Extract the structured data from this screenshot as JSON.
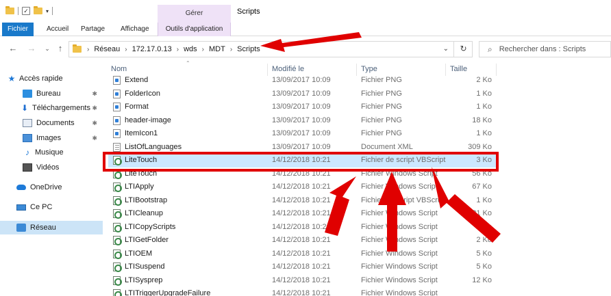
{
  "window": {
    "title": "Scripts",
    "context_group": "Gérer"
  },
  "ribbon": {
    "tabs": [
      {
        "label": "Fichier"
      },
      {
        "label": "Accueil"
      },
      {
        "label": "Partage"
      },
      {
        "label": "Affichage"
      },
      {
        "label": "Outils d'application"
      }
    ]
  },
  "address": {
    "crumbs": [
      "Réseau",
      "172.17.0.13",
      "wds",
      "MDT",
      "Scripts"
    ]
  },
  "search": {
    "placeholder": "Rechercher dans : Scripts"
  },
  "sidebar": {
    "items": [
      {
        "label": "Accès rapide",
        "icon": "star-icon"
      },
      {
        "label": "Bureau",
        "icon": "desktop-icon",
        "pinned": true
      },
      {
        "label": "Téléchargements",
        "icon": "download-icon",
        "pinned": true
      },
      {
        "label": "Documents",
        "icon": "documents-icon",
        "pinned": true
      },
      {
        "label": "Images",
        "icon": "images-icon",
        "pinned": true
      },
      {
        "label": "Musique",
        "icon": "music-icon"
      },
      {
        "label": "Vidéos",
        "icon": "videos-icon"
      },
      {
        "label": "OneDrive",
        "icon": "onedrive-icon"
      },
      {
        "label": "Ce PC",
        "icon": "computer-icon"
      },
      {
        "label": "Réseau",
        "icon": "network-icon",
        "selected": true
      }
    ]
  },
  "columns": {
    "name": "Nom",
    "date": "Modifié le",
    "type": "Type",
    "size": "Taille"
  },
  "files": [
    {
      "name": "Extend",
      "date": "13/09/2017 10:09",
      "type": "Fichier PNG",
      "size": "2 Ko",
      "kind": "png"
    },
    {
      "name": "FolderIcon",
      "date": "13/09/2017 10:09",
      "type": "Fichier PNG",
      "size": "1 Ko",
      "kind": "png"
    },
    {
      "name": "Format",
      "date": "13/09/2017 10:09",
      "type": "Fichier PNG",
      "size": "1 Ko",
      "kind": "png"
    },
    {
      "name": "header-image",
      "date": "13/09/2017 10:09",
      "type": "Fichier PNG",
      "size": "18 Ko",
      "kind": "png"
    },
    {
      "name": "ItemIcon1",
      "date": "13/09/2017 10:09",
      "type": "Fichier PNG",
      "size": "1 Ko",
      "kind": "png"
    },
    {
      "name": "ListOfLanguages",
      "date": "13/09/2017 10:09",
      "type": "Document XML",
      "size": "309 Ko",
      "kind": "xml"
    },
    {
      "name": "LiteTouch",
      "date": "14/12/2018 10:21",
      "type": "Fichier de script VBScript",
      "size": "3 Ko",
      "kind": "script",
      "highlighted": true
    },
    {
      "name": "LiteTouch",
      "date": "14/12/2018 10:21",
      "type": "Fichier Windows Script",
      "size": "56 Ko",
      "kind": "script"
    },
    {
      "name": "LTIApply",
      "date": "14/12/2018 10:21",
      "type": "Fichier Windows Script",
      "size": "67 Ko",
      "kind": "script"
    },
    {
      "name": "LTIBootstrap",
      "date": "14/12/2018 10:21",
      "type": "Fichier de script VBScript",
      "size": "1 Ko",
      "kind": "script"
    },
    {
      "name": "LTICleanup",
      "date": "14/12/2018 10:21",
      "type": "Fichier Windows Script",
      "size": "21 Ko",
      "kind": "script"
    },
    {
      "name": "LTICopyScripts",
      "date": "14/12/2018 10:21",
      "type": "Fichier Windows Script",
      "size": "4 Ko",
      "kind": "script"
    },
    {
      "name": "LTIGetFolder",
      "date": "14/12/2018 10:21",
      "type": "Fichier Windows Script",
      "size": "2 Ko",
      "kind": "script"
    },
    {
      "name": "LTIOEM",
      "date": "14/12/2018 10:21",
      "type": "Fichier Windows Script",
      "size": "5 Ko",
      "kind": "script"
    },
    {
      "name": "LTISuspend",
      "date": "14/12/2018 10:21",
      "type": "Fichier Windows Script",
      "size": "5 Ko",
      "kind": "script"
    },
    {
      "name": "LTISysprep",
      "date": "14/12/2018 10:21",
      "type": "Fichier Windows Script",
      "size": "12 Ko",
      "kind": "script"
    },
    {
      "name": "LTITriggerUpgradeFailure",
      "date": "14/12/2018 10:21",
      "type": "Fichier Windows Script",
      "size": "",
      "kind": "script"
    }
  ],
  "annotation": {
    "color": "#e00000"
  }
}
